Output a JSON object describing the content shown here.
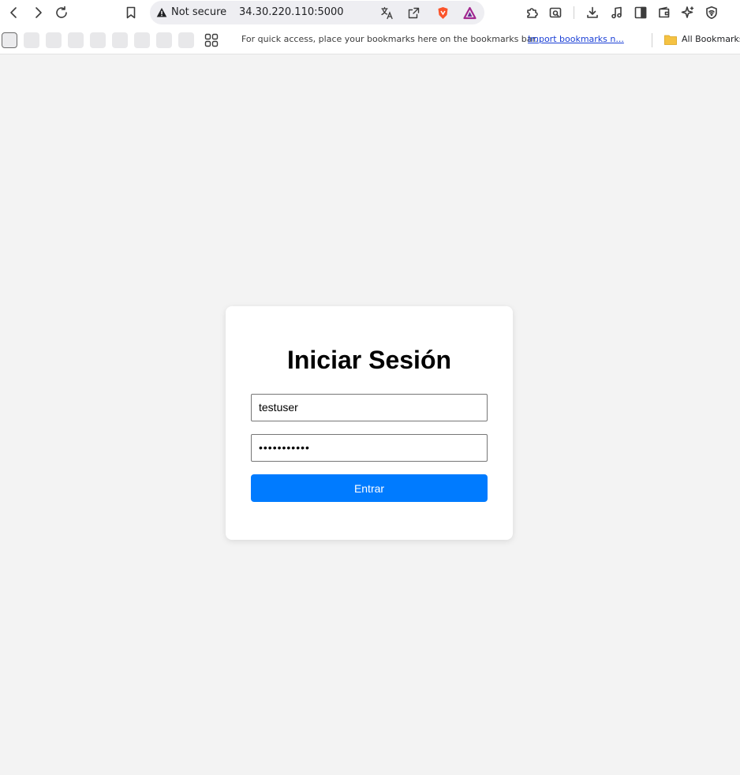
{
  "browser": {
    "security_label": "Not secure",
    "url": "34.30.220.110:5000",
    "bookmarks_hint": "For quick access, place your bookmarks here on the bookmarks bar.",
    "import_bookmarks": "Import bookmarks n...",
    "all_bookmarks": "All Bookmarks",
    "icons": [
      "back-icon",
      "forward-icon",
      "reload-icon",
      "bookmark-icon",
      "warning-icon",
      "translate-icon",
      "share-icon",
      "brave-shields-icon",
      "brave-rewards-icon",
      "extensions-icon",
      "screenshot-icon",
      "download-icon",
      "media-icon",
      "sidebar-icon",
      "wallet-icon",
      "leo-ai-icon",
      "vpn-icon",
      "apps-icon",
      "folder-icon"
    ]
  },
  "login": {
    "title": "Iniciar Sesión",
    "username_value": "testuser",
    "password_value": "•••••••••••",
    "submit_label": "Entrar"
  },
  "colors": {
    "page_background": "#f3f3f3",
    "card_background": "#ffffff",
    "primary_button": "#007bff",
    "button_text": "#ffffff"
  }
}
